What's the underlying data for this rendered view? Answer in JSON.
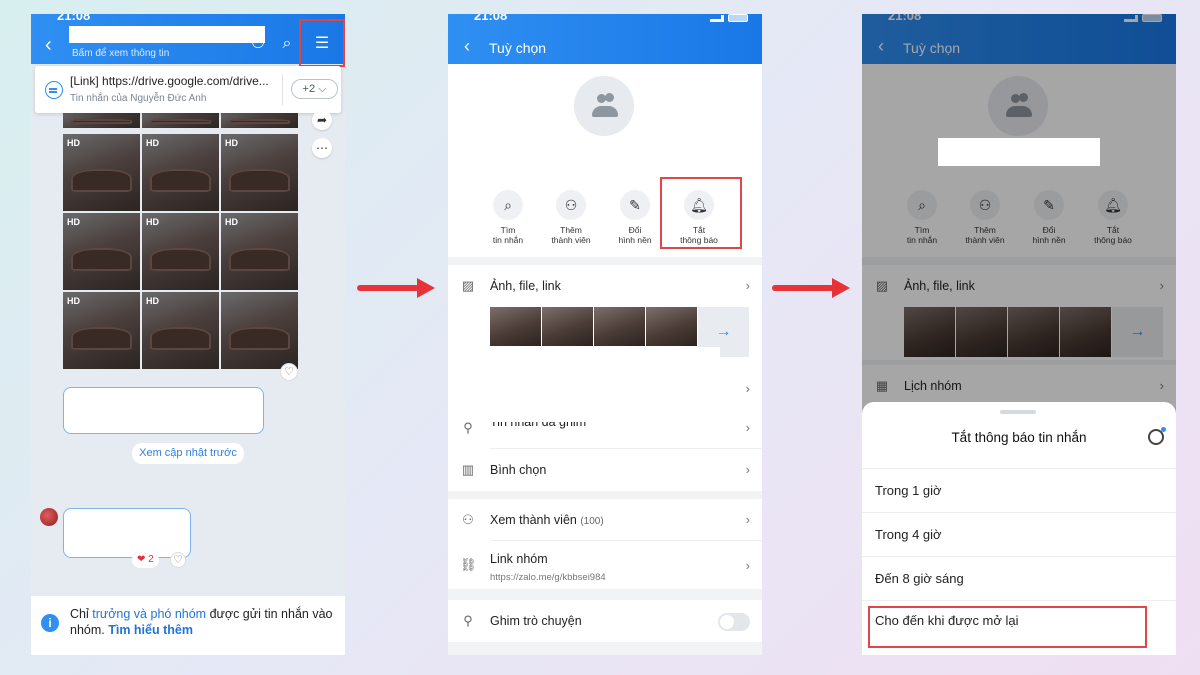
{
  "colors": {
    "accent": "#1a78e6",
    "highlight": "#e24545",
    "arrow": "#e8323a"
  },
  "phone1": {
    "status_time": "21:08",
    "header_subtitle": "Bấm để xem thông tin",
    "icons": [
      "back-icon",
      "add-member-icon",
      "search-icon",
      "menu-icon"
    ],
    "pinned": {
      "title": "[Link] https://drive.google.com/drive...",
      "subtitle": "Tin nhắn của Nguyễn Đức Anh",
      "count": "+2 ⌵"
    },
    "photo_badge": "HD",
    "earlier_updates": "Xem cập nhật trước",
    "reaction": "❤ 2",
    "info": {
      "prefix": "Chỉ ",
      "bold": "trưởng và phó nhóm",
      "middle": " được gửi tin nhắn vào nhóm. ",
      "link": "Tìm hiểu thêm"
    }
  },
  "phone2": {
    "status_time": "21:08",
    "title": "Tuỳ chọn",
    "quick_actions": [
      {
        "label": "Tìm\ntin nhắn",
        "icon": "search-icon"
      },
      {
        "label": "Thêm\nthành viên",
        "icon": "add-member-icon"
      },
      {
        "label": "Đổi\nhình nền",
        "icon": "brush-icon"
      },
      {
        "label": "Tắt\nthông báo",
        "icon": "bell-icon"
      }
    ],
    "rows": {
      "media": "Ảnh, file, link",
      "pinned": "Tin nhắn đã ghim",
      "poll": "Bình chọn",
      "members": "Xem thành viên",
      "members_count": "(100)",
      "group_link": "Link nhóm",
      "group_link_url": "https://zalo.me/g/kbbsei984",
      "pin_chat": "Ghim trò chuyện"
    }
  },
  "phone3": {
    "status_time": "21:08",
    "title": "Tuỳ chọn",
    "quick_actions": [
      {
        "label": "Tìm\ntin nhắn"
      },
      {
        "label": "Thêm\nthành viên"
      },
      {
        "label": "Đổi\nhình nền"
      },
      {
        "label": "Tắt\nthông báo"
      }
    ],
    "rows": {
      "media": "Ảnh, file, link",
      "calendar": "Lịch nhóm"
    },
    "sheet": {
      "title": "Tắt thông báo tin nhắn",
      "options": [
        "Trong 1 giờ",
        "Trong 4 giờ",
        "Đến 8 giờ sáng",
        "Cho đến khi được mở lại"
      ]
    }
  }
}
